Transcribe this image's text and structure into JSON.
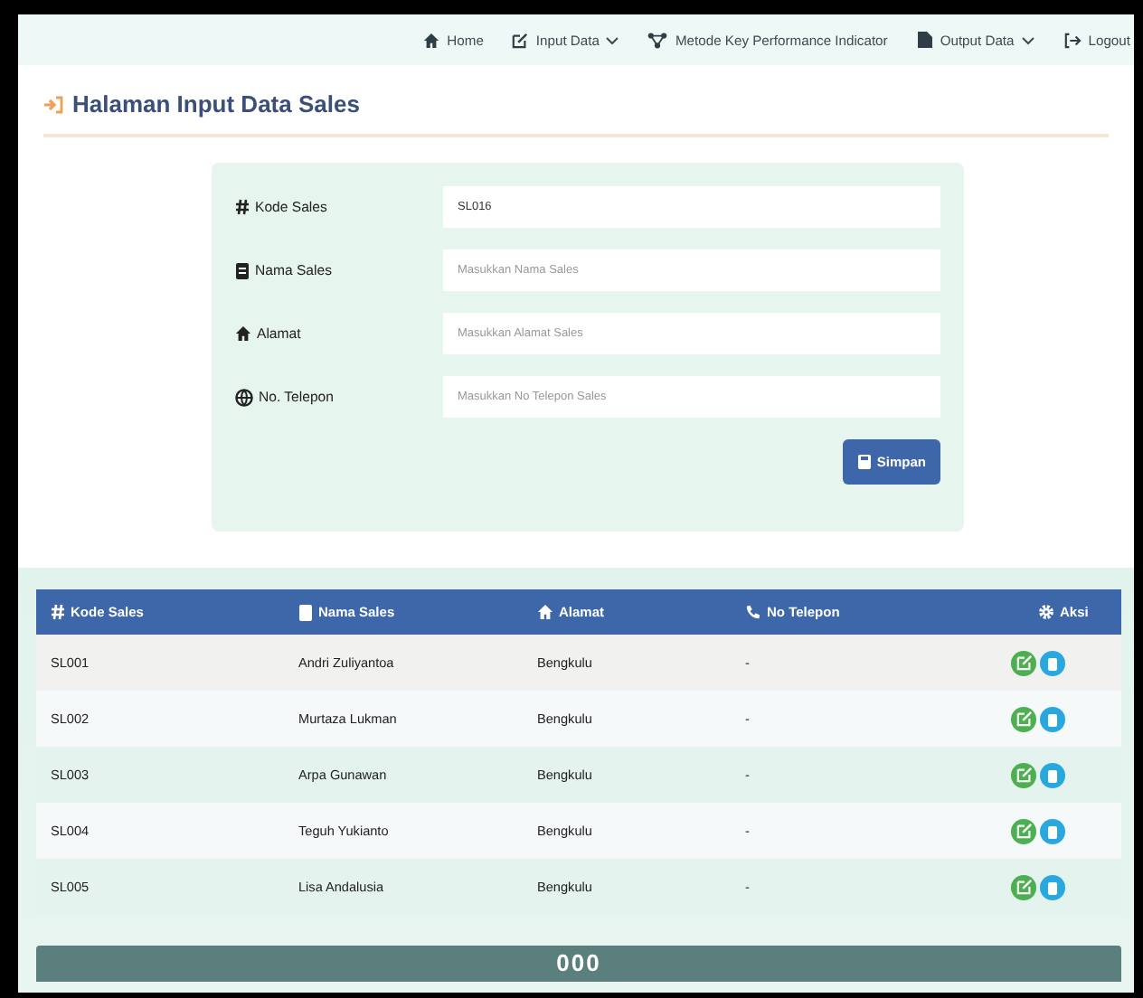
{
  "navbar": {
    "items": [
      {
        "kind": "home",
        "label": "Home",
        "dropdown": false
      },
      {
        "kind": "edit",
        "label": "Input Data",
        "dropdown": true
      },
      {
        "kind": "network",
        "label": "Metode Key Performance Indicator",
        "dropdown": false
      },
      {
        "kind": "file",
        "label": "Output Data",
        "dropdown": true
      },
      {
        "kind": "logout",
        "label": "Logout",
        "dropdown": false
      }
    ]
  },
  "page_title": "Halaman Input Data Sales",
  "form": {
    "fields": [
      {
        "kind": "hash",
        "label": "Kode Sales",
        "value": "SL016"
      },
      {
        "kind": "id",
        "label": "Nama Sales",
        "placeholder": "Masukkan Nama Sales"
      },
      {
        "kind": "home",
        "label": "Alamat",
        "placeholder": "Masukkan Alamat Sales"
      },
      {
        "kind": "globe",
        "label": "No. Telepon",
        "placeholder": "Masukkan No Telepon Sales"
      }
    ],
    "submit": "Simpan"
  },
  "table": {
    "columns": [
      {
        "kind": "hash",
        "label": "Kode Sales"
      },
      {
        "kind": "id",
        "label": "Nama Sales"
      },
      {
        "kind": "home",
        "label": "Alamat"
      },
      {
        "kind": "phone",
        "label": "No Telepon"
      },
      {
        "kind": "gear",
        "label": "Aksi"
      }
    ],
    "rows": [
      [
        "SL001",
        "Andri Zuliyantoa",
        "Bengkulu",
        "-"
      ],
      [
        "SL002",
        "Murtaza Lukman",
        "Bengkulu",
        "-"
      ],
      [
        "SL003",
        "Arpa Gunawan",
        "Bengkulu",
        "-"
      ],
      [
        "SL004",
        "Teguh Yukianto",
        "Bengkulu",
        "-"
      ],
      [
        "SL005",
        "Lisa Andalusia",
        "Bengkulu",
        "-"
      ]
    ]
  },
  "footer": "000"
}
